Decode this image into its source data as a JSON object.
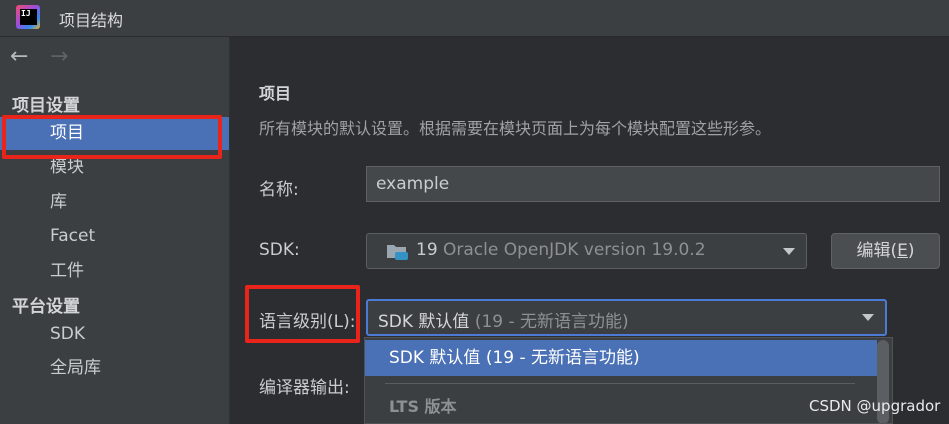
{
  "window": {
    "title": "项目结构",
    "logo_text": "IJ"
  },
  "sidebar": {
    "sections": [
      {
        "title": "项目设置",
        "items": [
          {
            "label": "项目",
            "selected": true
          },
          {
            "label": "模块"
          },
          {
            "label": "库"
          },
          {
            "label": "Facet"
          },
          {
            "label": "工件"
          }
        ]
      },
      {
        "title": "平台设置",
        "items": [
          {
            "label": "SDK"
          },
          {
            "label": "全局库"
          }
        ]
      }
    ]
  },
  "main": {
    "heading": "项目",
    "description": "所有模块的默认设置。根据需要在模块页面上为每个模块配置这些形参。",
    "name_label": "名称:",
    "name_value": "example",
    "sdk_label": "SDK:",
    "sdk_version": "19",
    "sdk_name": "Oracle OpenJDK version 19.0.2",
    "edit_button_label": "编辑(",
    "edit_button_mnemonic": "E",
    "edit_button_close": ")",
    "language_level_label": "语言级别(L):",
    "language_level_value": "SDK 默认值",
    "language_level_detail": "(19 - 无新语言功能)",
    "compiler_output_label": "编译器输出:"
  },
  "dropdown": {
    "selected_option": "SDK 默认值 (19 - 无新语言功能)",
    "group_header": "LTS 版本"
  },
  "watermark": "CSDN @upgrador",
  "colors": {
    "selection": "#4a70b5",
    "annotation": "#e8241b",
    "focus_border": "#4c7bd6"
  }
}
